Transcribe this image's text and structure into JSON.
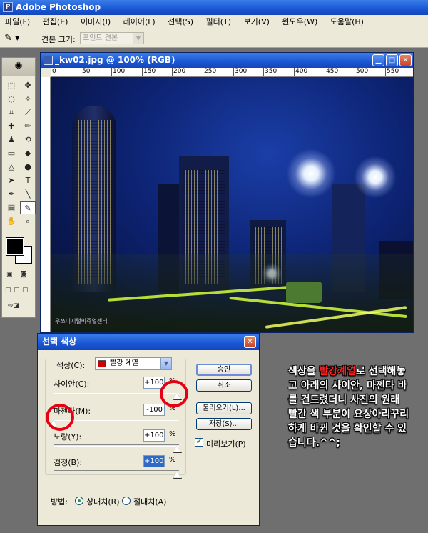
{
  "app": {
    "title": "Adobe Photoshop",
    "icon": "photoshop-app-icon"
  },
  "menu": [
    "파일(F)",
    "편집(E)",
    "이미지(I)",
    "레이어(L)",
    "선택(S)",
    "필터(T)",
    "보기(V)",
    "윈도우(W)",
    "도움말(H)"
  ],
  "options": {
    "brush_label": "견본 크기:",
    "brush_value": "포인트 견본"
  },
  "document": {
    "title": "_kw02.jpg @ 100% (RGB)",
    "ruler_ticks": [
      "0",
      "50",
      "100",
      "150",
      "200",
      "250",
      "300",
      "350",
      "400",
      "450",
      "500",
      "550"
    ],
    "watermark": "우쓰디지털비쥬얼센터"
  },
  "dialog": {
    "title": "선택 색상",
    "color_label": "색상(C):",
    "color_value": "빨강 계열",
    "color_swatch": "#cc0000",
    "sliders": [
      {
        "label": "사이안(C):",
        "value": "+100",
        "level": 100
      },
      {
        "label": "마젠타(M):",
        "value": "-100",
        "level": -100
      },
      {
        "label": "노랑(Y):",
        "value": "+100",
        "level": 100
      },
      {
        "label": "검정(B):",
        "value": "+100",
        "level": 100
      }
    ],
    "percent": "%",
    "buttons": {
      "ok": "승인",
      "cancel": "취소",
      "load": "불러오기(L)...",
      "save": "저장(S)..."
    },
    "preview_label": "미리보기(P)",
    "method_label": "방법:",
    "method_relative": "상대치(R)",
    "method_absolute": "절대치(A)"
  },
  "annotation": {
    "part1": "색상을 ",
    "highlight": "빨강계열",
    "part2": "로 선택해놓고 아래의 사이안, 마젠타 바를 건드렸더니 사진의 원래 빨간 색 부분이 요상아리꾸리하게 바뀐 것을 확인할 수 있습니다.^^;",
    "highlight_color": "#ff2020"
  }
}
